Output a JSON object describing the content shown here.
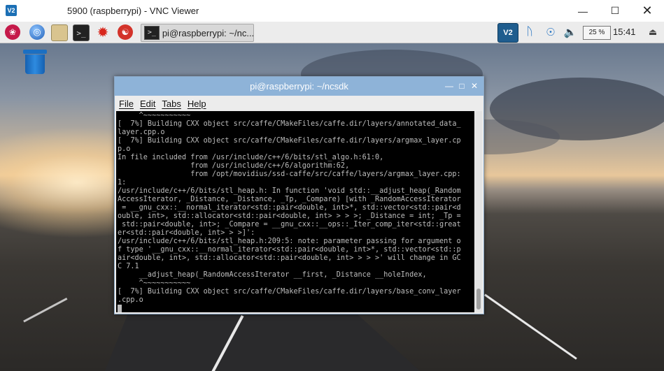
{
  "window": {
    "title": "5900 (raspberrypi) - VNC Viewer",
    "minimize_icon": "minimize-icon",
    "maximize_icon": "maximize-icon",
    "close_icon": "close-icon"
  },
  "taskbar": {
    "launchers": [
      "raspberry-menu-icon",
      "browser-globe-icon",
      "file-manager-icon",
      "terminal-icon",
      "mathematica-icon",
      "wolfram-icon"
    ],
    "task_label": "pi@raspberrypi: ~/nc...",
    "cpu": "25 %",
    "clock": "15:41",
    "tray": [
      "vnc-server-icon",
      "bluetooth-icon",
      "wifi-icon",
      "volume-icon",
      "eject-icon"
    ]
  },
  "terminal": {
    "title": "pi@raspberrypi: ~/ncsdk",
    "menu": {
      "file": "File",
      "edit": "Edit",
      "tabs": "Tabs",
      "help": "Help"
    },
    "lines": [
      "     ^~~~~~~~~~~~",
      "[  7%] Building CXX object src/caffe/CMakeFiles/caffe.dir/layers/annotated_data_",
      "layer.cpp.o",
      "[  7%] Building CXX object src/caffe/CMakeFiles/caffe.dir/layers/argmax_layer.cp",
      "p.o",
      "In file included from /usr/include/c++/6/bits/stl_algo.h:61:0,",
      "                 from /usr/include/c++/6/algorithm:62,",
      "                 from /opt/movidius/ssd-caffe/src/caffe/layers/argmax_layer.cpp:",
      "1:",
      "/usr/include/c++/6/bits/stl_heap.h: In function 'void std::__adjust_heap(_Random",
      "AccessIterator, _Distance, _Distance, _Tp, _Compare) [with _RandomAccessIterator",
      " = __gnu_cxx::__normal_iterator<std::pair<double, int>*, std::vector<std::pair<d",
      "ouble, int>, std::allocator<std::pair<double, int> > > >; _Distance = int; _Tp =",
      " std::pair<double, int>; _Compare = __gnu_cxx::__ops::_Iter_comp_iter<std::great",
      "er<std::pair<double, int> > >]':",
      "/usr/include/c++/6/bits/stl_heap.h:209:5: note: parameter passing for argument o",
      "f type '__gnu_cxx::__normal_iterator<std::pair<double, int>*, std::vector<std::p",
      "air<double, int>, std::allocator<std::pair<double, int> > > >' will change in GC",
      "C 7.1",
      "     __adjust_heap(_RandomAccessIterator __first, _Distance __holeIndex,",
      "     ^~~~~~~~~~~~",
      "[  7%] Building CXX object src/caffe/CMakeFiles/caffe.dir/layers/base_conv_layer",
      ".cpp.o"
    ]
  },
  "desktop": {
    "trash_icon": "trash-icon"
  }
}
